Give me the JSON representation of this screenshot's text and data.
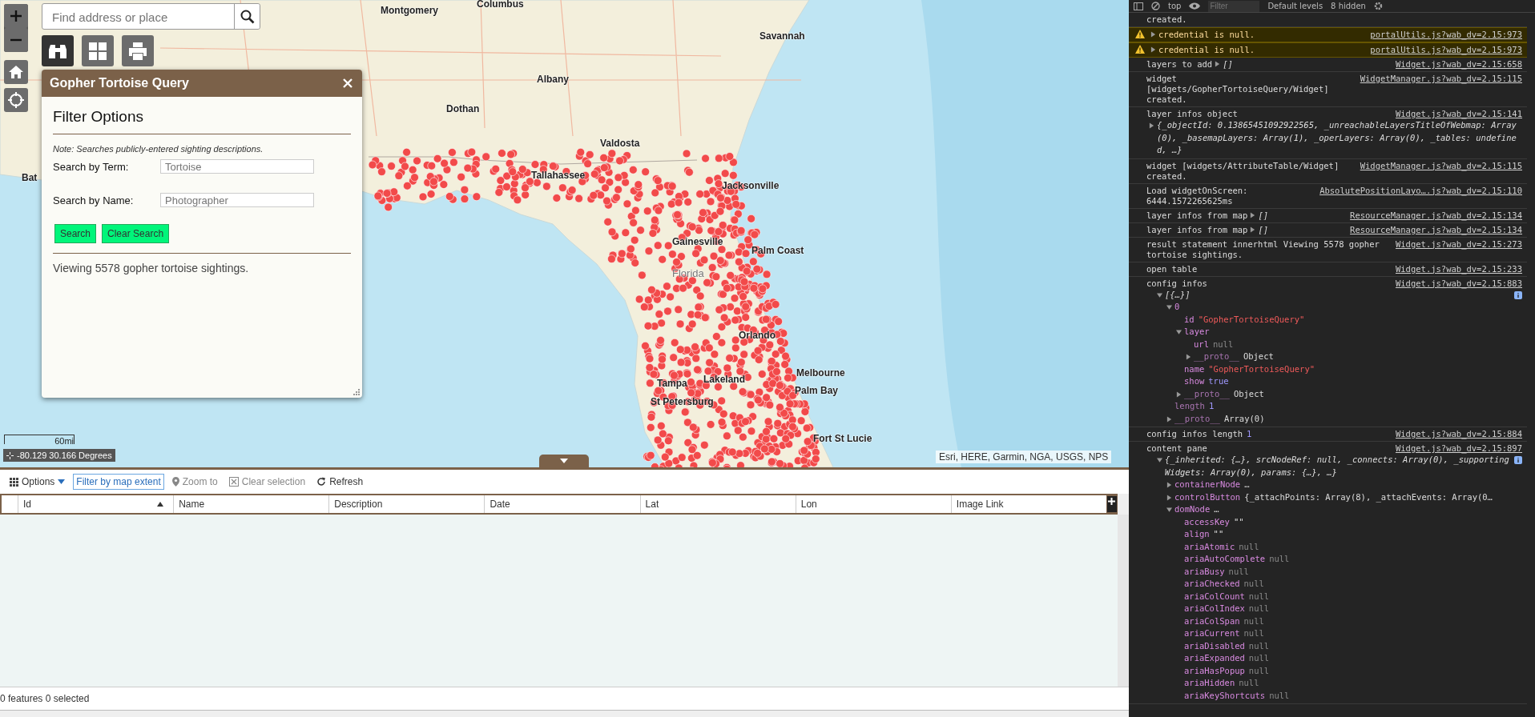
{
  "map": {
    "search": {
      "placeholder": "Find address or place"
    },
    "labels": [
      {
        "text": "Montgomery",
        "kind": "city"
      },
      {
        "text": "Columbus",
        "kind": "city"
      },
      {
        "text": "Savannah",
        "kind": "city"
      },
      {
        "text": "Albany",
        "kind": "city"
      },
      {
        "text": "Dothan",
        "kind": "city"
      },
      {
        "text": "Valdosta",
        "kind": "city"
      },
      {
        "text": "Tallahassee",
        "kind": "city"
      },
      {
        "text": "Jacksonville",
        "kind": "city"
      },
      {
        "text": "Gainesville",
        "kind": "city"
      },
      {
        "text": "Palm Coast",
        "kind": "city"
      },
      {
        "text": "Florida",
        "kind": "region"
      },
      {
        "text": "Orlando",
        "kind": "city"
      },
      {
        "text": "Melbourne",
        "kind": "city"
      },
      {
        "text": "Palm Bay",
        "kind": "city"
      },
      {
        "text": "Tampa",
        "kind": "city"
      },
      {
        "text": "Lakeland",
        "kind": "city"
      },
      {
        "text": "St Petersburg",
        "kind": "city"
      },
      {
        "text": "Fort St Lucie",
        "kind": "city"
      },
      {
        "text": "Bat",
        "kind": "city"
      }
    ],
    "scale": "60mi",
    "coordinates": "-80.129 30.166 Degrees",
    "attribution": "Esri, HERE, Garmin, NGA, USGS, NPS"
  },
  "widget": {
    "title": "Gopher Tortoise Query",
    "heading": "Filter Options",
    "note": "Note: Searches publicly-entered sighting descriptions.",
    "fields": [
      {
        "label": "Search by Term:",
        "placeholder": "Tortoise"
      },
      {
        "label": "Search by Name:",
        "placeholder": "Photographer"
      }
    ],
    "buttons": [
      "Search",
      "Clear Search"
    ],
    "result": "Viewing 5578 gopher tortoise sightings."
  },
  "attribute_table": {
    "toolbar": [
      {
        "label": "Options",
        "kind": "menu",
        "disabled": false
      },
      {
        "label": "Filter by map extent",
        "kind": "toggle",
        "disabled": false
      },
      {
        "label": "Zoom to",
        "kind": "zoom",
        "disabled": true
      },
      {
        "label": "Clear selection",
        "kind": "clear",
        "disabled": true
      },
      {
        "label": "Refresh",
        "kind": "refresh",
        "disabled": false
      }
    ],
    "columns": [
      {
        "label": "Id",
        "sorted": true
      },
      {
        "label": "Name",
        "sorted": false
      },
      {
        "label": "Description",
        "sorted": false
      },
      {
        "label": "Date",
        "sorted": false
      },
      {
        "label": "Lat",
        "sorted": false
      },
      {
        "label": "Lon",
        "sorted": false
      },
      {
        "label": "Image Link",
        "sorted": false
      }
    ],
    "status": "0 features 0 selected"
  },
  "console": {
    "toolbar": {
      "context": "top",
      "filter_placeholder": "Filter",
      "levels": "Default levels",
      "hidden": "8 hidden"
    },
    "entries": [
      {
        "kind": "log",
        "text": "created."
      },
      {
        "kind": "warning",
        "text": "credential is null.",
        "expanded": false,
        "source": "portalUtils.js?wab_dv=2.15:973"
      },
      {
        "kind": "warning",
        "text": "credential is null.",
        "expanded": false,
        "source": "portalUtils.js?wab_dv=2.15:973"
      },
      {
        "kind": "log",
        "text": "layers to add",
        "inline": {
          "text": "[]",
          "expanded": false
        },
        "source": "Widget.js?wab_dv=2.15:658"
      },
      {
        "kind": "log",
        "text": "widget [widgets/GopherTortoiseQuery/Widget] created.",
        "source": "WidgetManager.js?wab_dv=2.15:115"
      },
      {
        "kind": "log",
        "text": "layer infos object",
        "source": "Widget.js?wab_dv=2.15:141",
        "summary": {
          "text": "{_objectId: 0.13865451092922565, _unreachableLayersTitleOfWebmap: Array(0), _basemapLayers: Array(1), _operLayers: Array(0), _tables: undefined, …}",
          "expanded": false
        }
      },
      {
        "kind": "log",
        "text": "widget [widgets/AttributeTable/Widget] created.",
        "source": "WidgetManager.js?wab_dv=2.15:115"
      },
      {
        "kind": "log",
        "text": "Load widgetOnScreen: 6444.1572265625ms",
        "source": "AbsolutePositionLayo….js?wab_dv=2.15:110"
      },
      {
        "kind": "log",
        "text": "layer infos from map",
        "inline": {
          "text": "[]",
          "expanded": false
        },
        "source": "ResourceManager.js?wab_dv=2.15:134"
      },
      {
        "kind": "log",
        "text": "layer infos from map",
        "inline": {
          "text": "[]",
          "expanded": false
        },
        "source": "ResourceManager.js?wab_dv=2.15:134"
      },
      {
        "kind": "log",
        "text": "result statement innerhtml  Viewing 5578 gopher tortoise sightings.",
        "source": "Widget.js?wab_dv=2.15:273"
      },
      {
        "kind": "log",
        "text": "open table",
        "source": "Widget.js?wab_dv=2.15:233"
      },
      {
        "kind": "log",
        "text": "config infos",
        "source": "Widget.js?wab_dv=2.15:883",
        "tree": [
          {
            "summary": "[{…}]",
            "kind": "branch",
            "expanded": true,
            "children": [
              {
                "key": "0",
                "kind": "branch",
                "expanded": true,
                "enumerable": true,
                "children": [
                  {
                    "key": "id",
                    "kind": "leaf",
                    "enumerable": true,
                    "value": {
                      "text": "\"GopherTortoiseQuery\"",
                      "kind": "string"
                    }
                  },
                  {
                    "key": "layer",
                    "kind": "branch",
                    "expanded": true,
                    "enumerable": true,
                    "children": [
                      {
                        "key": "url",
                        "kind": "leaf",
                        "enumerable": true,
                        "value": {
                          "text": "null",
                          "kind": "null"
                        }
                      },
                      {
                        "key": "__proto__",
                        "kind": "branch",
                        "expanded": false,
                        "enumerable": false,
                        "value": {
                          "text": "Object",
                          "kind": "object"
                        }
                      }
                    ]
                  },
                  {
                    "key": "name",
                    "kind": "leaf",
                    "enumerable": true,
                    "value": {
                      "text": "\"GopherTortoiseQuery\"",
                      "kind": "string"
                    }
                  },
                  {
                    "key": "show",
                    "kind": "leaf",
                    "enumerable": true,
                    "value": {
                      "text": "true",
                      "kind": "number"
                    }
                  },
                  {
                    "key": "__proto__",
                    "kind": "branch",
                    "expanded": false,
                    "enumerable": false,
                    "value": {
                      "text": "Object",
                      "kind": "object"
                    }
                  }
                ]
              },
              {
                "key": "length",
                "kind": "leaf",
                "enumerable": false,
                "value": {
                  "text": "1",
                  "kind": "number"
                }
              },
              {
                "key": "__proto__",
                "kind": "branch",
                "expanded": false,
                "enumerable": false,
                "value": {
                  "text": "Array(0)",
                  "kind": "object"
                }
              }
            ]
          }
        ]
      },
      {
        "kind": "log",
        "text": "config infos length",
        "value": {
          "text": "1",
          "kind": "number"
        },
        "source": "Widget.js?wab_dv=2.15:884"
      },
      {
        "kind": "log",
        "text": "content pane",
        "source": "Widget.js?wab_dv=2.15:897",
        "tree": [
          {
            "summary": "{_inherited: {…}, srcNodeRef: null, _connects: Array(0), _supportingWidgets: Array(0), params: {…}, …}",
            "kind": "branch",
            "expanded": true,
            "children": [
              {
                "key": "containerNode",
                "kind": "branch",
                "expanded": false,
                "enumerable": true,
                "value": {
                  "text": "…",
                  "kind": "object"
                }
              },
              {
                "key": "controlButton",
                "kind": "branch",
                "expanded": false,
                "enumerable": true,
                "value": {
                  "text": "{_attachPoints: Array(8), _attachEvents: Array(0…",
                  "kind": "object"
                }
              },
              {
                "key": "domNode",
                "kind": "branch",
                "expanded": true,
                "enumerable": true,
                "value": {
                  "text": "…",
                  "kind": "object"
                },
                "children": [
                  {
                    "key": "accessKey",
                    "kind": "leaf",
                    "enumerable": true,
                    "value": {
                      "text": "\"\"",
                      "kind": "object"
                    }
                  },
                  {
                    "key": "align",
                    "kind": "leaf",
                    "enumerable": true,
                    "value": {
                      "text": "\"\"",
                      "kind": "object"
                    }
                  },
                  {
                    "key": "ariaAtomic",
                    "kind": "leaf",
                    "enumerable": true,
                    "value": {
                      "text": "null",
                      "kind": "null"
                    }
                  },
                  {
                    "key": "ariaAutoComplete",
                    "kind": "leaf",
                    "enumerable": true,
                    "value": {
                      "text": "null",
                      "kind": "null"
                    }
                  },
                  {
                    "key": "ariaBusy",
                    "kind": "leaf",
                    "enumerable": true,
                    "value": {
                      "text": "null",
                      "kind": "null"
                    }
                  },
                  {
                    "key": "ariaChecked",
                    "kind": "leaf",
                    "enumerable": true,
                    "value": {
                      "text": "null",
                      "kind": "null"
                    }
                  },
                  {
                    "key": "ariaColCount",
                    "kind": "leaf",
                    "enumerable": true,
                    "value": {
                      "text": "null",
                      "kind": "null"
                    }
                  },
                  {
                    "key": "ariaColIndex",
                    "kind": "leaf",
                    "enumerable": true,
                    "value": {
                      "text": "null",
                      "kind": "null"
                    }
                  },
                  {
                    "key": "ariaColSpan",
                    "kind": "leaf",
                    "enumerable": true,
                    "value": {
                      "text": "null",
                      "kind": "null"
                    }
                  },
                  {
                    "key": "ariaCurrent",
                    "kind": "leaf",
                    "enumerable": true,
                    "value": {
                      "text": "null",
                      "kind": "null"
                    }
                  },
                  {
                    "key": "ariaDisabled",
                    "kind": "leaf",
                    "enumerable": true,
                    "value": {
                      "text": "null",
                      "kind": "null"
                    }
                  },
                  {
                    "key": "ariaExpanded",
                    "kind": "leaf",
                    "enumerable": true,
                    "value": {
                      "text": "null",
                      "kind": "null"
                    }
                  },
                  {
                    "key": "ariaHasPopup",
                    "kind": "leaf",
                    "enumerable": true,
                    "value": {
                      "text": "null",
                      "kind": "null"
                    }
                  },
                  {
                    "key": "ariaHidden",
                    "kind": "leaf",
                    "enumerable": true,
                    "value": {
                      "text": "null",
                      "kind": "null"
                    }
                  },
                  {
                    "key": "ariaKeyShortcuts",
                    "kind": "leaf",
                    "enumerable": true,
                    "value": {
                      "text": "null",
                      "kind": "null"
                    }
                  }
                ]
              }
            ]
          }
        ]
      }
    ]
  }
}
